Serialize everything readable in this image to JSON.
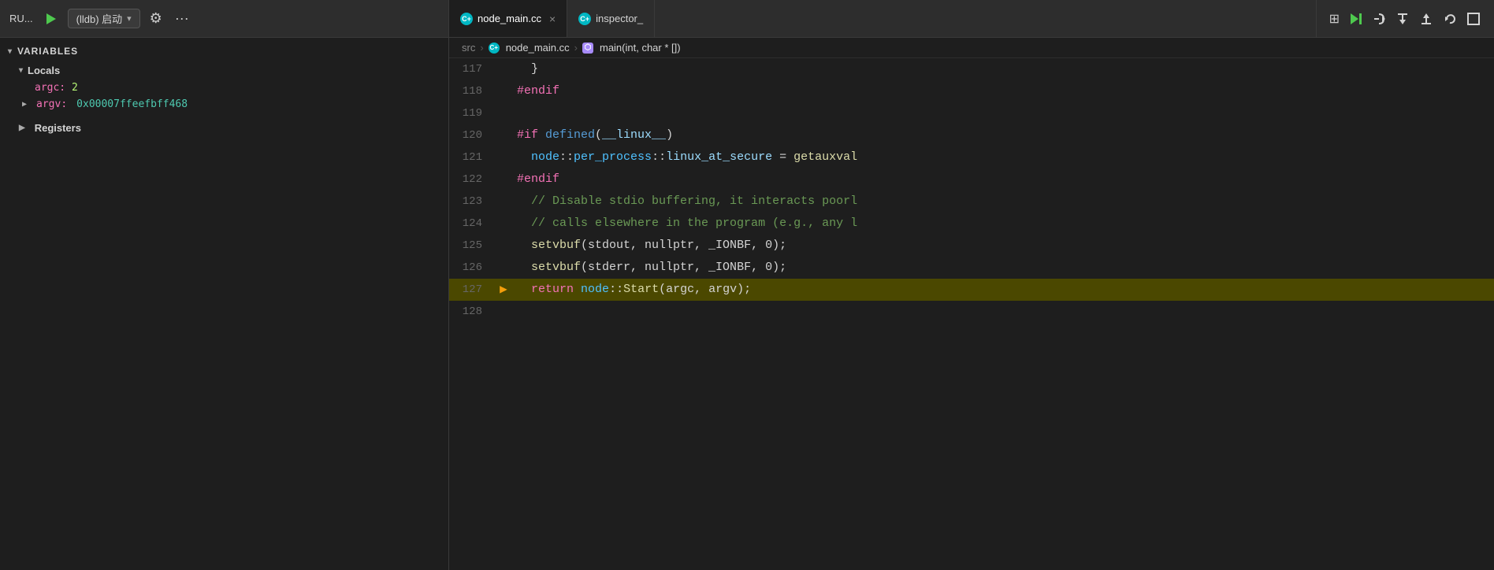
{
  "topbar": {
    "debug_label": "RU...",
    "session": "(lldb) 启动",
    "gear_icon": "⚙",
    "more_icon": "···",
    "tabs": [
      {
        "id": "node_main",
        "label": "node_main.cc",
        "active": true,
        "icon_type": "cpp"
      },
      {
        "id": "inspector",
        "label": "inspector_",
        "active": false,
        "icon_type": "cpp"
      }
    ],
    "debug_buttons": [
      {
        "id": "grid-icon",
        "symbol": "⊞"
      },
      {
        "id": "continue-icon",
        "symbol": "▶|"
      },
      {
        "id": "step-over-icon",
        "symbol": "↺"
      },
      {
        "id": "step-into-icon",
        "symbol": "↓"
      },
      {
        "id": "step-out-icon",
        "symbol": "↑"
      },
      {
        "id": "restart-icon",
        "symbol": "↩"
      },
      {
        "id": "stop-icon",
        "symbol": "□"
      }
    ]
  },
  "sidebar": {
    "variables_label": "VARIABLES",
    "locals_label": "Locals",
    "argc_name": "argc:",
    "argc_value": "2",
    "argv_name": "argv:",
    "argv_value": "0x00007ffeefbff468",
    "registers_label": "Registers"
  },
  "breadcrumb": {
    "src": "src",
    "sep1": ">",
    "file": "node_main.cc",
    "sep2": ">",
    "func": "main(int, char * [])"
  },
  "code_lines": [
    {
      "num": "117",
      "gutter": "",
      "content_parts": [
        {
          "text": "  }",
          "cls": "op"
        }
      ],
      "highlighted": false
    },
    {
      "num": "118",
      "gutter": "",
      "content_parts": [
        {
          "text": "#endif",
          "cls": "kw"
        }
      ],
      "highlighted": false
    },
    {
      "num": "119",
      "gutter": "",
      "content_parts": [
        {
          "text": "",
          "cls": ""
        }
      ],
      "highlighted": false
    },
    {
      "num": "120",
      "gutter": "",
      "content_parts": [
        {
          "text": "#if ",
          "cls": "kw"
        },
        {
          "text": "defined",
          "cls": "defined-fn"
        },
        {
          "text": "(__linux__)",
          "cls": "linux-macro"
        }
      ],
      "highlighted": false
    },
    {
      "num": "121",
      "gutter": "",
      "content_parts": [
        {
          "text": "  node::",
          "cls": "ns"
        },
        {
          "text": "per_process",
          "cls": "ns"
        },
        {
          "text": "::",
          "cls": "op"
        },
        {
          "text": "linux_at_secure",
          "cls": "var2"
        },
        {
          "text": " = ",
          "cls": "op"
        },
        {
          "text": "getauxval",
          "cls": "fn"
        },
        {
          "text": "...",
          "cls": "op"
        }
      ],
      "highlighted": false
    },
    {
      "num": "122",
      "gutter": "",
      "content_parts": [
        {
          "text": "#endif",
          "cls": "kw"
        }
      ],
      "highlighted": false
    },
    {
      "num": "123",
      "gutter": "",
      "content_parts": [
        {
          "text": "  ",
          "cls": ""
        },
        {
          "text": "// Disable stdio buffering, it interacts poorl...",
          "cls": "cmt"
        }
      ],
      "highlighted": false
    },
    {
      "num": "124",
      "gutter": "",
      "content_parts": [
        {
          "text": "  ",
          "cls": ""
        },
        {
          "text": "// calls elsewhere in the program (e.g., any l...",
          "cls": "cmt"
        }
      ],
      "highlighted": false
    },
    {
      "num": "125",
      "gutter": "",
      "content_parts": [
        {
          "text": "  ",
          "cls": ""
        },
        {
          "text": "setvbuf",
          "cls": "fn"
        },
        {
          "text": "(stdout, nullptr, _IONBF, 0);",
          "cls": "op"
        }
      ],
      "highlighted": false
    },
    {
      "num": "126",
      "gutter": "",
      "content_parts": [
        {
          "text": "  ",
          "cls": ""
        },
        {
          "text": "setvbuf",
          "cls": "fn"
        },
        {
          "text": "(stderr, nullptr, _IONBF, 0);",
          "cls": "op"
        }
      ],
      "highlighted": false
    },
    {
      "num": "127",
      "gutter": "▶",
      "content_parts": [
        {
          "text": "  ",
          "cls": ""
        },
        {
          "text": "return",
          "cls": "kw"
        },
        {
          "text": " node::",
          "cls": "ns"
        },
        {
          "text": "Start",
          "cls": "fn"
        },
        {
          "text": "(argc, argv);",
          "cls": "op"
        }
      ],
      "highlighted": true
    },
    {
      "num": "128",
      "gutter": "",
      "content_parts": [
        {
          "text": "",
          "cls": ""
        }
      ],
      "highlighted": false
    }
  ]
}
